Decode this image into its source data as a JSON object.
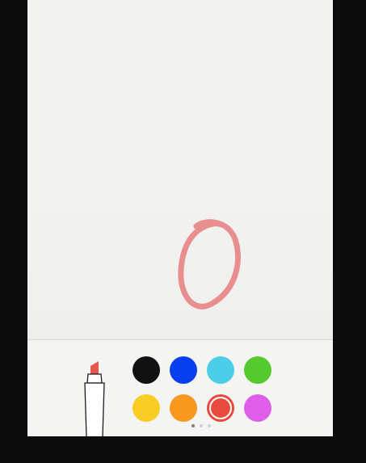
{
  "app": {
    "canvas": {
      "stroke_color": "#e67d7d"
    },
    "toolbar": {
      "active_tool": "marker",
      "active_tool_tip_color": "#e8574c",
      "colors": [
        {
          "name": "black",
          "hex": "#111111",
          "selected": false
        },
        {
          "name": "blue",
          "hex": "#0a3ff0",
          "selected": false
        },
        {
          "name": "light-blue",
          "hex": "#4ccde8",
          "selected": false
        },
        {
          "name": "green",
          "hex": "#56c92f",
          "selected": false
        },
        {
          "name": "yellow",
          "hex": "#f8cd24",
          "selected": false
        },
        {
          "name": "orange",
          "hex": "#f7981f",
          "selected": false
        },
        {
          "name": "red",
          "hex": "#e84a3e",
          "selected": true
        },
        {
          "name": "purple",
          "hex": "#df5ee8",
          "selected": false
        }
      ],
      "page_indicator": {
        "count": 3,
        "active_index": 0
      }
    }
  }
}
